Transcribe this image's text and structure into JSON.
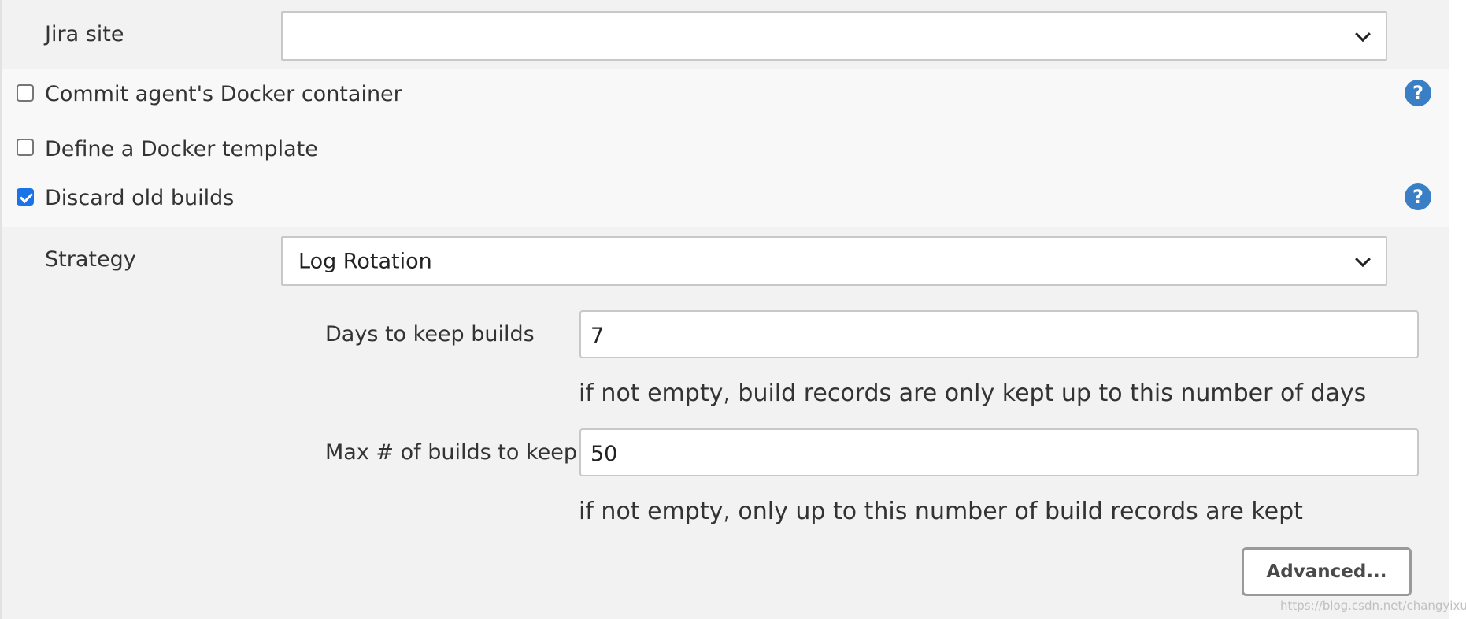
{
  "jira": {
    "label": "Jira site",
    "value": ""
  },
  "options": {
    "commit_agent": {
      "label": "Commit agent's Docker container",
      "checked": false
    },
    "docker_template": {
      "label": "Define a Docker template",
      "checked": false
    },
    "discard_builds": {
      "label": "Discard old builds",
      "checked": true
    }
  },
  "help_icon_glyph": "?",
  "strategy": {
    "label": "Strategy",
    "value": "Log Rotation"
  },
  "days_to_keep": {
    "label": "Days to keep builds",
    "value": "7",
    "hint": "if not empty, build records are only kept up to this number of days"
  },
  "max_builds": {
    "label": "Max # of builds to keep",
    "value": "50",
    "hint": "if not empty, only up to this number of build records are kept"
  },
  "advanced_button": {
    "label": "Advanced..."
  },
  "watermark": "https://blog.csdn.net/changyixue",
  "colors": {
    "checkbox_checked": "#1a73e8",
    "help_icon": "#3a7fc5",
    "panel": "#f2f2f2"
  }
}
